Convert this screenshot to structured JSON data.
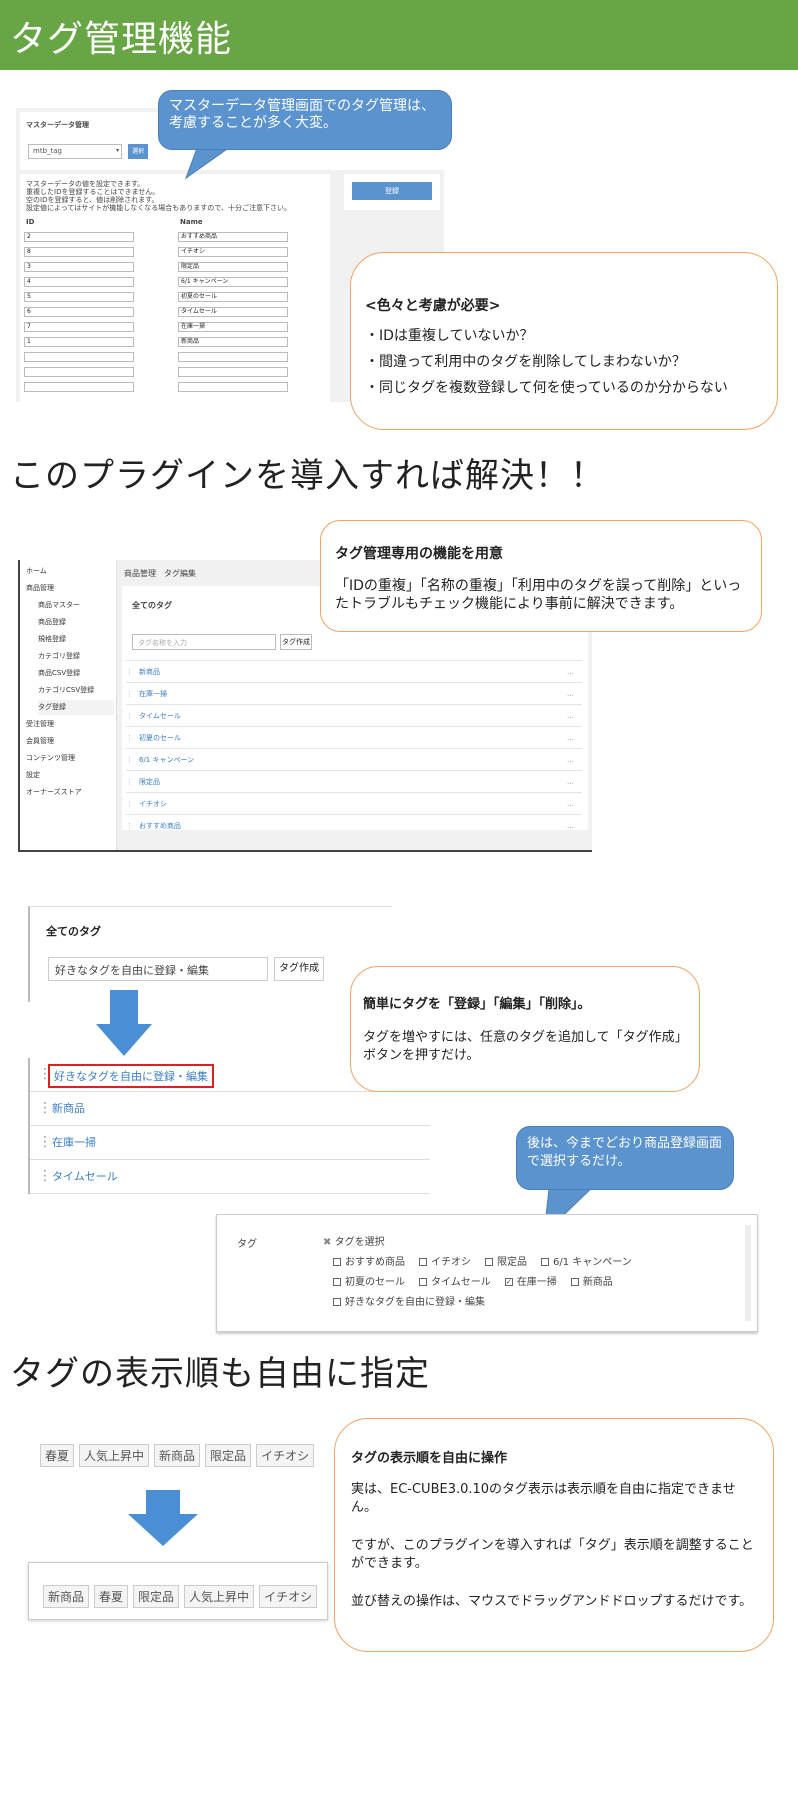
{
  "header": {
    "title": "タグ管理機能"
  },
  "section1": {
    "panel_title": "マスターデータ管理",
    "select_value": "mtb_tag",
    "select_button": "選択",
    "notes": [
      "マスターデータの値を設定できます。",
      "重複したIDを登録することはできません。",
      "空のIDを登録すると、値は削除されます。",
      "設定値によってはサイトが機能しなくなる場合もありますので、十分ご注意下さい。"
    ],
    "register_button": "登録",
    "table": {
      "headers": [
        "ID",
        "Name"
      ],
      "rows": [
        [
          "2",
          "おすすめ商品"
        ],
        [
          "8",
          "イチオシ"
        ],
        [
          "3",
          "限定品"
        ],
        [
          "4",
          "6/1 キャンペーン"
        ],
        [
          "5",
          "初夏のセール"
        ],
        [
          "6",
          "タイムセール"
        ],
        [
          "7",
          "在庫一掃"
        ],
        [
          "1",
          "新商品"
        ],
        [
          "",
          ""
        ],
        [
          "",
          ""
        ],
        [
          "",
          ""
        ]
      ]
    },
    "callout": "マスターデータ管理画面でのタグ管理は、考慮することが多く大変。",
    "issues_title": "<色々と考慮が必要>",
    "issues": [
      "・IDは重複していないか？",
      "・間違って利用中のタグを削除してしまわないか？",
      "・同じタグを複数登録して何を使っているのか分からない"
    ]
  },
  "headline1": "このプラグインを導入すれば解決！！",
  "section2": {
    "sidebar": [
      "ホーム",
      "商品管理",
      "商品マスター",
      "商品登録",
      "規格登録",
      "カテゴリ登録",
      "商品CSV登録",
      "カテゴリCSV登録",
      "タグ登録",
      "受注管理",
      "会員管理",
      "コンテンツ管理",
      "設定",
      "オーナーズストア"
    ],
    "breadcrumb": "商品管理　タグ編集",
    "card_title": "全てのタグ",
    "input_placeholder": "タグ名称を入力",
    "create_button": "タグ作成",
    "tags": [
      "新商品",
      "在庫一掃",
      "タイムセール",
      "初夏のセール",
      "6/1 キャンペーン",
      "限定品",
      "イチオシ",
      "おすすめ商品"
    ],
    "more": "…",
    "callout_title": "タグ管理専用の機能を用意",
    "callout_body": "「IDの重複」「名称の重複」「利用中のタグを誤って削除」といったトラブルもチェック機能により事前に解決できます。"
  },
  "section3": {
    "card_title": "全てのタグ",
    "input_value": "好きなタグを自由に登録・編集",
    "create_button": "タグ作成",
    "tags": [
      "好きなタグを自由に登録・編集",
      "新商品",
      "在庫一掃",
      "タイムセール"
    ],
    "callout_title": "簡単にタグを「登録」「編集」「削除」。",
    "callout_body": "タグを増やすには、任意のタグを追加して「タグ作成」ボタンを押すだけ。",
    "callout2": "後は、今までどおり商品登録画面で選択するだけ。",
    "tag_label": "タグ",
    "select_label": "タグを選択",
    "options": [
      {
        "label": "おすすめ商品",
        "checked": false
      },
      {
        "label": "イチオシ",
        "checked": false
      },
      {
        "label": "限定品",
        "checked": false
      },
      {
        "label": "6/1 キャンペーン",
        "checked": false
      },
      {
        "label": "初夏のセール",
        "checked": false
      },
      {
        "label": "タイムセール",
        "checked": false
      },
      {
        "label": "在庫一掃",
        "checked": true
      },
      {
        "label": "新商品",
        "checked": false
      },
      {
        "label": "好きなタグを自由に登録・編集",
        "checked": false
      }
    ]
  },
  "headline2": "タグの表示順も自由に指定",
  "section4": {
    "before": [
      "春夏",
      "人気上昇中",
      "新商品",
      "限定品",
      "イチオシ"
    ],
    "after": [
      "新商品",
      "春夏",
      "限定品",
      "人気上昇中",
      "イチオシ"
    ],
    "callout_title": "タグの表示順を自由に操作",
    "p1": "実は、EC-CUBE3.0.10のタグ表示は表示順を自由に指定できません。",
    "p2": "ですが、このプラグインを導入すれば「タグ」表示順を調整することができます。",
    "p3": "並び替えの操作は、マウスでドラッグアンドドロップするだけです。"
  },
  "colors": {
    "header": "#68a645",
    "callout_blue": "#5b93cf",
    "callout_border": "#f0a265",
    "arrow": "#4a8fd6",
    "link": "#3b7ec7",
    "highlight": "#e02020"
  }
}
